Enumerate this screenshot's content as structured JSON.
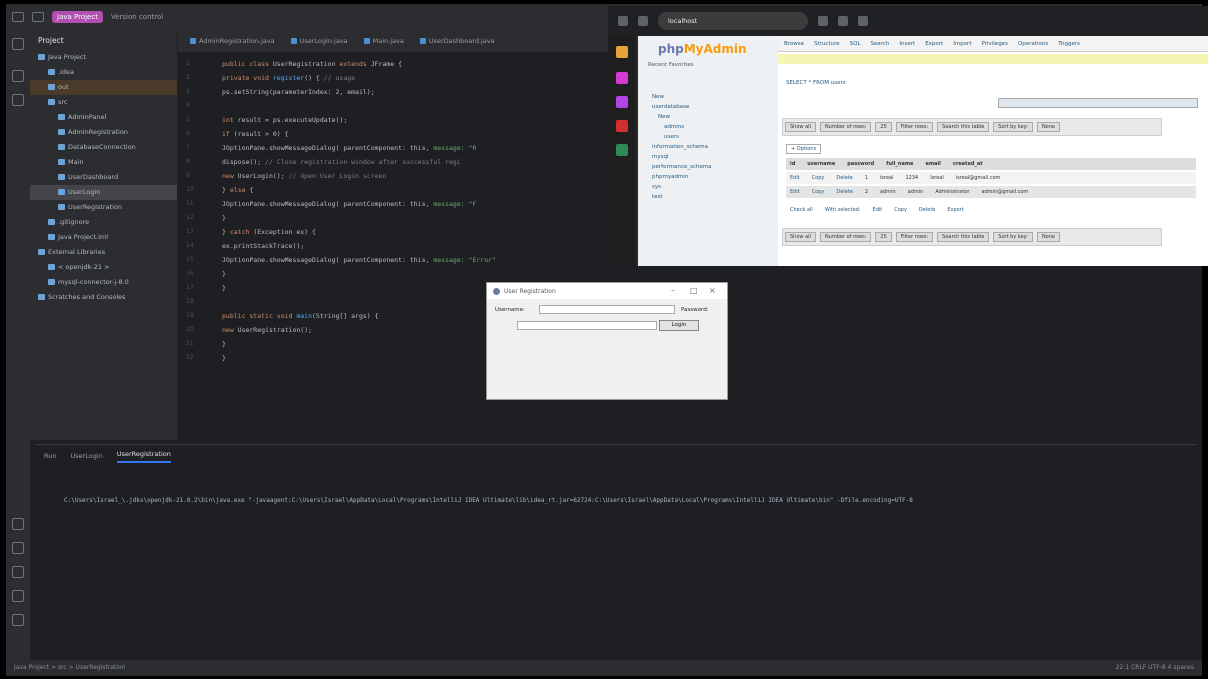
{
  "ide": {
    "project_badge": "Java Project",
    "vcs_label": "Version control",
    "panel_title": "Project",
    "tree": [
      {
        "label": "Java Project",
        "state": "normal"
      },
      {
        "label": ".idea",
        "state": "normal"
      },
      {
        "label": "out",
        "state": "highlight"
      },
      {
        "label": "src",
        "state": "normal"
      },
      {
        "label": "AdminPanel",
        "state": "normal"
      },
      {
        "label": "AdminRegistration",
        "state": "normal"
      },
      {
        "label": "DatabaseConnection",
        "state": "normal"
      },
      {
        "label": "Main",
        "state": "normal"
      },
      {
        "label": "UserDashboard",
        "state": "normal"
      },
      {
        "label": "UserLogin",
        "state": "selected"
      },
      {
        "label": "UserRegistration",
        "state": "normal"
      },
      {
        "label": ".gitignore",
        "state": "normal"
      },
      {
        "label": "Java Project.iml",
        "state": "normal"
      },
      {
        "label": "External Libraries",
        "state": "normal"
      },
      {
        "label": "< openjdk-21 >",
        "state": "normal"
      },
      {
        "label": "mysql-connector-j-8.0",
        "state": "normal"
      },
      {
        "label": "Scratches and Consoles",
        "state": "normal"
      }
    ],
    "tabs": [
      "AdminRegistration.java",
      "UserLogin.java",
      "Main.java",
      "UserDashboard.java"
    ],
    "code_lines": [
      {
        "n": "1",
        "parts": [
          [
            "kw",
            "public class "
          ],
          [
            "pl",
            "UserRegistration "
          ],
          [
            "kw",
            "extends "
          ],
          [
            "pl",
            "JFrame {"
          ]
        ]
      },
      {
        "n": "2",
        "parts": [
          [
            "kw",
            "    private void "
          ],
          [
            "fn",
            "register"
          ],
          [
            "pl",
            "() { "
          ],
          [
            "cm",
            "// usage"
          ]
        ]
      },
      {
        "n": "3",
        "parts": [
          [
            "pl",
            "            ps.setString(parameterIndex: 2, email);"
          ]
        ]
      },
      {
        "n": "4",
        "parts": [
          [
            "pl",
            ""
          ]
        ]
      },
      {
        "n": "5",
        "parts": [
          [
            "kw",
            "            int "
          ],
          [
            "pl",
            "result = ps.executeUpdate();"
          ]
        ]
      },
      {
        "n": "6",
        "parts": [
          [
            "kw",
            "            if "
          ],
          [
            "pl",
            "(result > 0) {"
          ]
        ]
      },
      {
        "n": "7",
        "parts": [
          [
            "pl",
            "                JOptionPane.showMessageDialog( parentComponent: this, "
          ],
          [
            "st",
            "message: \"R"
          ]
        ]
      },
      {
        "n": "8",
        "parts": [
          [
            "pl",
            "                dispose(); "
          ],
          [
            "cm",
            "// Close registration window after successful regi"
          ]
        ]
      },
      {
        "n": "9",
        "parts": [
          [
            "kw",
            "                new "
          ],
          [
            "pl",
            "UserLogin(); "
          ],
          [
            "cm",
            "// Open User Login screen"
          ]
        ]
      },
      {
        "n": "10",
        "parts": [
          [
            "pl",
            "            } "
          ],
          [
            "kw",
            "else "
          ],
          [
            "pl",
            "{"
          ]
        ]
      },
      {
        "n": "11",
        "parts": [
          [
            "pl",
            "                JOptionPane.showMessageDialog( parentComponent: this, "
          ],
          [
            "st",
            "message: \"F"
          ]
        ]
      },
      {
        "n": "12",
        "parts": [
          [
            "pl",
            "            }"
          ]
        ]
      },
      {
        "n": "13",
        "parts": [
          [
            "pl",
            "        } "
          ],
          [
            "kw",
            "catch "
          ],
          [
            "pl",
            "(Exception ex) {"
          ]
        ]
      },
      {
        "n": "14",
        "parts": [
          [
            "pl",
            "            ex.printStackTrace();"
          ]
        ]
      },
      {
        "n": "15",
        "parts": [
          [
            "pl",
            "            JOptionPane.showMessageDialog( parentComponent: this, "
          ],
          [
            "st",
            "message: \"Error\""
          ]
        ]
      },
      {
        "n": "16",
        "parts": [
          [
            "pl",
            "        }"
          ]
        ]
      },
      {
        "n": "17",
        "parts": [
          [
            "pl",
            "    }"
          ]
        ]
      },
      {
        "n": "18",
        "parts": [
          [
            "pl",
            ""
          ]
        ]
      },
      {
        "n": "19",
        "parts": [
          [
            "kw",
            "    public static void "
          ],
          [
            "fn",
            "main"
          ],
          [
            "pl",
            "(String[] args) {"
          ]
        ]
      },
      {
        "n": "20",
        "parts": [
          [
            "kw",
            "        new "
          ],
          [
            "pl",
            "UserRegistration();"
          ]
        ]
      },
      {
        "n": "21",
        "parts": [
          [
            "pl",
            "    }"
          ]
        ]
      },
      {
        "n": "22",
        "parts": [
          [
            "pl",
            "}"
          ]
        ]
      }
    ],
    "run_tabs": [
      "Run",
      "UserLogin",
      "UserRegistration"
    ],
    "run_output": "C:\\Users\\Israel_\\.jdks\\openjdk-21.0.2\\bin\\java.exe \"-javaagent:C:\\Users\\Israel\\AppData\\Local\\Programs\\IntelliJ IDEA Ultimate\\lib\\idea_rt.jar=62724:C:\\Users\\Israel\\AppData\\Local\\Programs\\IntelliJ IDEA Ultimate\\bin\" -Dfile.encoding=UTF-8",
    "status_left": "Java Project > src > UserRegistration",
    "status_right": "22:1   CRLF   UTF-8   4 spaces"
  },
  "browser": {
    "url": "localhost",
    "pma_logo_a": "php",
    "pma_logo_b": "MyAdmin",
    "pma_recent": "Recent   Favorites",
    "databases": [
      "New",
      "userdatabase",
      "New",
      "admins",
      "users",
      "information_schema",
      "mysql",
      "performance_schema",
      "phpmyadmin",
      "sys",
      "test"
    ],
    "nav": [
      "Browse",
      "Structure",
      "SQL",
      "Search",
      "Insert",
      "Export",
      "Import",
      "Privileges",
      "Operations",
      "Triggers"
    ],
    "query_text": "SELECT * FROM users",
    "buttons": [
      "Show all",
      "Number of rows:",
      "25",
      "Filter rows:",
      "Search this table",
      "Sort by key:",
      "None"
    ],
    "columns": [
      "id",
      "username",
      "password",
      "full_name",
      "email",
      "created_at"
    ],
    "rows": [
      [
        "Edit",
        "Copy",
        "Delete",
        "1",
        "isreal",
        "1234",
        "Isreal",
        "isreal@gmail.com"
      ],
      [
        "Edit",
        "Copy",
        "Delete",
        "2",
        "admin",
        "admin",
        "Administrator",
        "admin@gmail.com"
      ]
    ],
    "actions": [
      "Check all",
      "With selected:",
      "Edit",
      "Copy",
      "Delete",
      "Export"
    ]
  },
  "dialog": {
    "title": "User Registration",
    "label_user": "Username:",
    "label_pass": "Password:",
    "button": "Login"
  }
}
